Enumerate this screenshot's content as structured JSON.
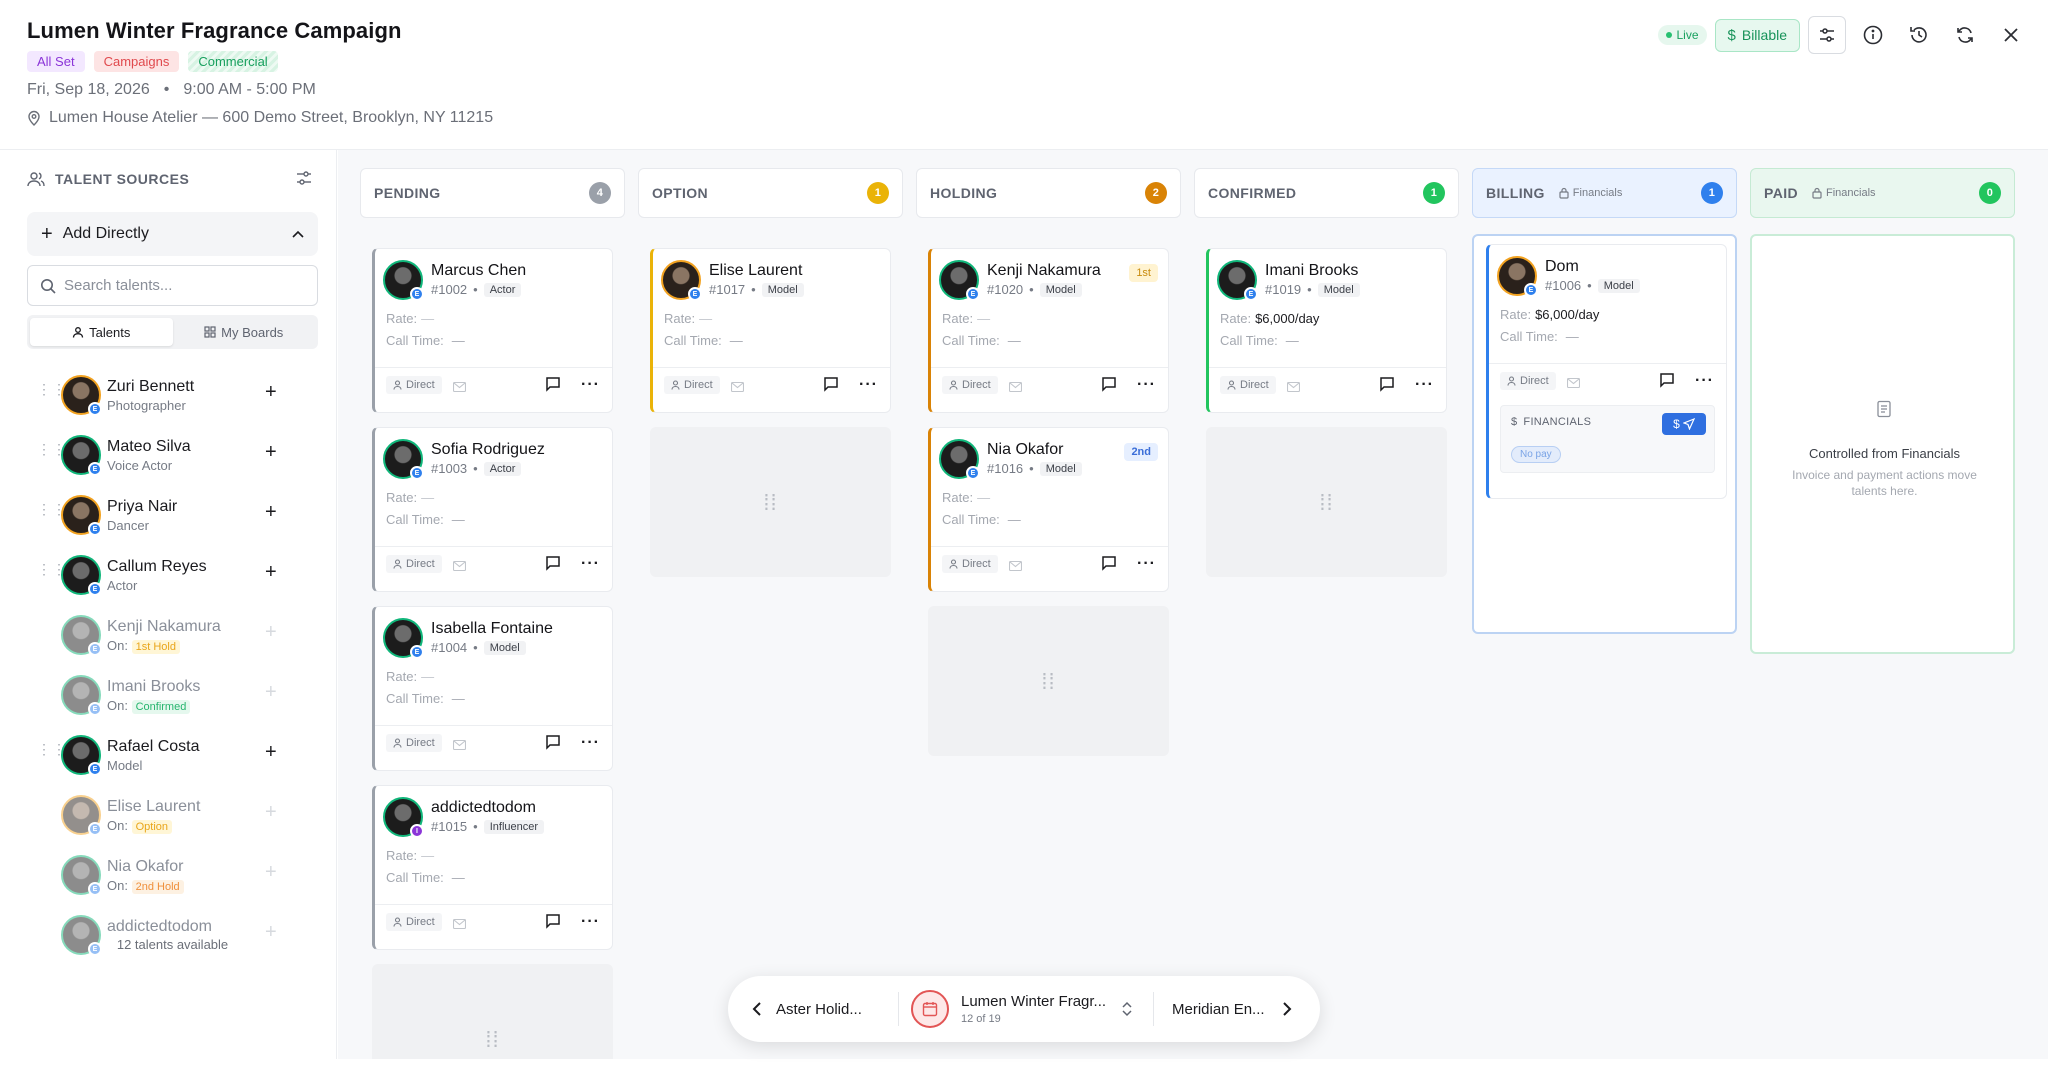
{
  "header": {
    "title": "Lumen Winter Fragrance Campaign",
    "tags": [
      "All Set",
      "Campaigns",
      "Commercial"
    ],
    "date": "Fri, Sep 18, 2026",
    "separator": "•",
    "time": "9:00 AM - 5:00 PM",
    "location": "Lumen House Atelier — 600 Demo Street, Brooklyn, NY 11215",
    "status_live": "Live",
    "billable_label": "Billable"
  },
  "sidebar": {
    "heading": "TALENT SOURCES",
    "add_directly": "Add Directly",
    "search_placeholder": "Search talents...",
    "tabs": [
      "Talents",
      "My Boards"
    ],
    "talents": [
      {
        "name": "Zuri Bennett",
        "sub": "Photographer",
        "dim": false,
        "ring": "orange"
      },
      {
        "name": "Mateo Silva",
        "sub": "Voice Actor",
        "dim": false,
        "ring": "green"
      },
      {
        "name": "Priya Nair",
        "sub": "Dancer",
        "dim": false,
        "ring": "orange"
      },
      {
        "name": "Callum Reyes",
        "sub": "Actor",
        "dim": false,
        "ring": "green"
      },
      {
        "name": "Kenji Nakamura",
        "on": "On:",
        "status": "1st Hold",
        "scolor": "y",
        "dim": true,
        "ring": "green"
      },
      {
        "name": "Imani Brooks",
        "on": "On:",
        "status": "Confirmed",
        "scolor": "g",
        "dim": true,
        "ring": "green"
      },
      {
        "name": "Rafael Costa",
        "sub": "Model",
        "dim": false,
        "ring": "green"
      },
      {
        "name": "Elise Laurent",
        "on": "On:",
        "status": "Option",
        "scolor": "y",
        "dim": true,
        "ring": "orange"
      },
      {
        "name": "Nia Okafor",
        "on": "On:",
        "status": "2nd Hold",
        "scolor": "o",
        "dim": true,
        "ring": "green"
      },
      {
        "name": "addictedtodom",
        "sub": "",
        "dim": true,
        "ring": "green"
      }
    ],
    "footer": "12 talents available"
  },
  "labels": {
    "rate": "Rate:",
    "call_time": "Call Time:",
    "dash": "—",
    "direct": "Direct",
    "financials": "FINANCIALS",
    "no_pay": "No pay"
  },
  "columns": [
    {
      "title": "PENDING",
      "count": "4",
      "color": "#9aa0a9"
    },
    {
      "title": "OPTION",
      "count": "1",
      "color": "#eab308"
    },
    {
      "title": "HOLDING",
      "count": "2",
      "color": "#d98306"
    },
    {
      "title": "CONFIRMED",
      "count": "1",
      "color": "#22c55e"
    },
    {
      "title": "BILLING",
      "count": "1",
      "color": "#2f80ed",
      "locked": "Financials"
    },
    {
      "title": "PAID",
      "count": "0",
      "color": "#22c55e",
      "locked": "Financials"
    }
  ],
  "cards": {
    "pending": [
      {
        "name": "Marcus Chen",
        "id": "#1002",
        "role": "Actor"
      },
      {
        "name": "Sofia Rodriguez",
        "id": "#1003",
        "role": "Actor"
      },
      {
        "name": "Isabella Fontaine",
        "id": "#1004",
        "role": "Model"
      },
      {
        "name": "addictedtodom",
        "id": "#1015",
        "role": "Influencer"
      }
    ],
    "option": [
      {
        "name": "Elise Laurent",
        "id": "#1017",
        "role": "Model"
      }
    ],
    "holding": [
      {
        "name": "Kenji Nakamura",
        "id": "#1020",
        "role": "Model",
        "hold": "1st"
      },
      {
        "name": "Nia Okafor",
        "id": "#1016",
        "role": "Model",
        "hold": "2nd"
      }
    ],
    "confirmed": [
      {
        "name": "Imani Brooks",
        "id": "#1019",
        "role": "Model",
        "rate": "$6,000/day"
      }
    ],
    "billing": [
      {
        "name": "Dom",
        "id": "#1006",
        "role": "Model",
        "rate": "$6,000/day"
      }
    ]
  },
  "paid": {
    "title": "Controlled from Financials",
    "desc_line1": "Invoice and payment actions move",
    "desc_line2": "talents here."
  },
  "bottom_nav": {
    "prev": "Aster Holid...",
    "current": "Lumen Winter Fragr...",
    "position": "12 of 19",
    "next": "Meridian En..."
  }
}
